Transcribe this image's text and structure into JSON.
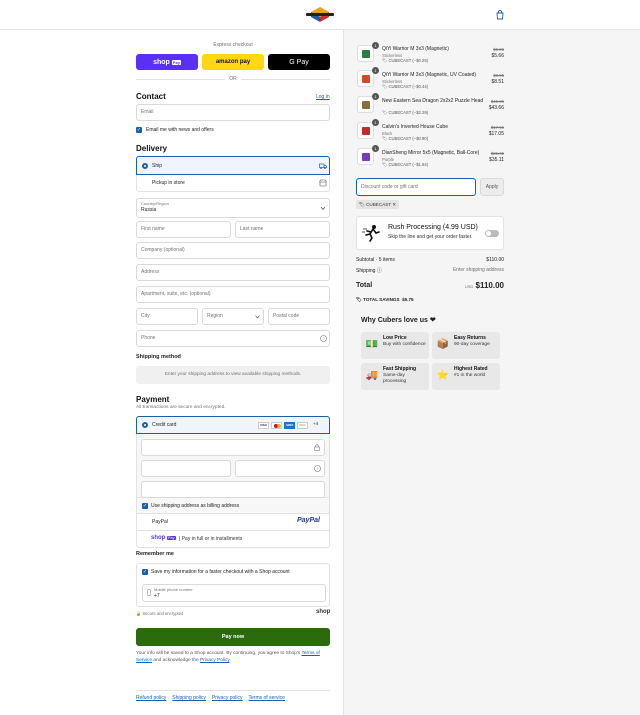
{
  "header": {
    "logo_alt": "store logo"
  },
  "express": {
    "label": "Express checkout",
    "shop_pay_label": "shop",
    "shop_pay_badge": "Pay",
    "amazon_label": "amazon pay",
    "gpay_label": "G Pay",
    "or_label": "OR"
  },
  "contact": {
    "title": "Contact",
    "login_link": "Log in",
    "email_placeholder": "Email",
    "newsletter_label": "Email me with news and offers"
  },
  "delivery": {
    "title": "Delivery",
    "ship_label": "Ship",
    "pickup_label": "Pickup in store",
    "country_label": "Country/Region",
    "country_value": "Russia",
    "first_name": "First name",
    "last_name": "Last name",
    "company": "Company (optional)",
    "address": "Address",
    "apartment": "Apartment, suite, etc. (optional)",
    "city": "City",
    "region": "Region",
    "postal": "Postal code",
    "phone": "Phone"
  },
  "shipping_method": {
    "title": "Shipping method",
    "notice": "Enter your shipping address to view available shipping methods."
  },
  "payment": {
    "title": "Payment",
    "subtitle": "All transactions are secure and encrypted.",
    "credit_card_label": "Credit card",
    "card_brands": [
      "VISA",
      "MC",
      "AMEX",
      "DISC",
      "+4"
    ],
    "billing_same_label": "Use shipping address as billing address",
    "paypal_label": "PayPal",
    "paypal_logo": "PayPal",
    "shoppay_logo": "shop",
    "shoppay_badge": "Pay",
    "shoppay_desc": "Pay in full or in installments"
  },
  "remember": {
    "title": "Remember me",
    "save_label": "Save my information for a faster checkout with a Shop account",
    "phone_label": "Mobile phone number",
    "phone_value": "+7",
    "secure_label": "Secure and encrypted",
    "shop_brand": "shop"
  },
  "pay_button": "Pay now",
  "legal": {
    "text1": "Your info will be saved to a Shop account. By continuing, you agree to Shop's",
    "terms": "Terms of Service",
    "text2": "and acknowledge the",
    "privacy": "Privacy Policy",
    "end": "."
  },
  "footer_links": [
    "Refund policy",
    "Shipping policy",
    "Privacy policy",
    "Terms of service"
  ],
  "cart": {
    "items": [
      {
        "qty": "1",
        "title": "QiYi Warrior M 3x3 (Magnetic)",
        "variant": "Stickerless",
        "discount": "CUBECAST (−$0.29)",
        "old_price": "$5.95",
        "price": "$5.66",
        "color": "#2a7d3a"
      },
      {
        "qty": "1",
        "title": "QiYi Warrior M 3x3 (Magnetic, UV Coated)",
        "variant": "Stickerless",
        "discount": "CUBECAST (−$0.44)",
        "old_price": "$8.95",
        "price": "$8.51",
        "color": "#d04a24"
      },
      {
        "qty": "1",
        "title": "New Eastern Sea Dragon 2x2x2 Puzzle Head",
        "variant": "",
        "discount": "CUBECAST (−$2.29)",
        "old_price": "$45.95",
        "price": "$43.66",
        "color": "#8a6d3b"
      },
      {
        "qty": "1",
        "title": "Calvin's Inverted House Cube",
        "variant": "Black",
        "discount": "CUBECAST (−$0.90)",
        "old_price": "$17.95",
        "price": "$17.05",
        "color": "#c02a2a"
      },
      {
        "qty": "1",
        "title": "DianSheng Mirror 5x5 (Magnetic, Ball-Core)",
        "variant": "Purple",
        "discount": "CUBECAST (−$1.84)",
        "old_price": "$36.95",
        "price": "$35.11",
        "color": "#7a3bb8"
      }
    ],
    "discount_placeholder": "Discount code or gift card",
    "apply_label": "Apply",
    "applied_code": "CUBECAST",
    "rush": {
      "title": "Rush Processing (4.99 USD)",
      "desc": "Skip the line and get your order faster."
    },
    "subtotal_label": "Subtotal · 5 items",
    "subtotal_value": "$110.00",
    "shipping_label": "Shipping",
    "shipping_value": "Enter shipping address",
    "total_label": "Total",
    "currency": "USD",
    "total_value": "$110.00",
    "savings_label": "TOTAL SAVINGS",
    "savings_value": "$5.75",
    "why_title": "Why Cubers love us ❤",
    "why": [
      {
        "title": "Low Price",
        "desc": "Buy with confidence",
        "icon": "💵"
      },
      {
        "title": "Easy Returns",
        "desc": "90-day coverage",
        "icon": "📦"
      },
      {
        "title": "Fast Shipping",
        "desc": "Same-day processing",
        "icon": "🚚"
      },
      {
        "title": "Highest Rated",
        "desc": "#1 in the world",
        "icon": "⭐"
      }
    ]
  },
  "colors": {
    "accent": "#1c5fa9",
    "pay_button": "#2b6b0e",
    "shop_pay": "#5a31f4",
    "amazon": "#ffd814"
  }
}
